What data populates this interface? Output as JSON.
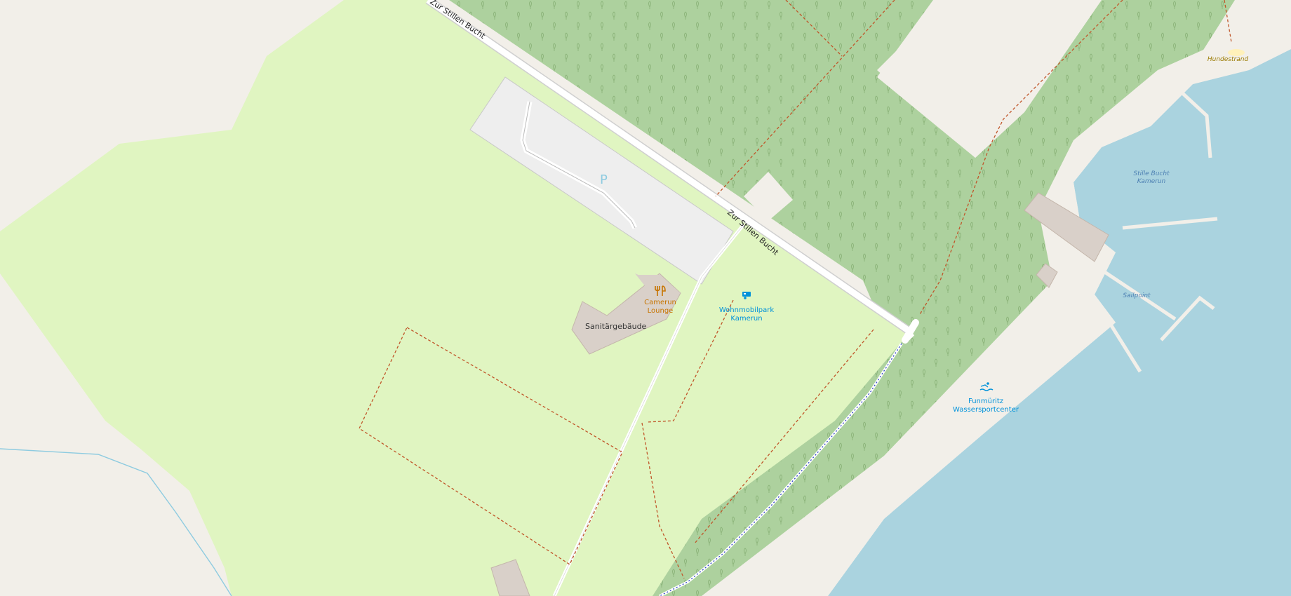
{
  "map": {
    "roads": {
      "road_label_top": "Zur Stillen Bucht",
      "road_label_mid": "Zur Stillen Bucht"
    },
    "parking": {
      "symbol": "P"
    },
    "buildings": {
      "sanitary": "Sanitärgebäude"
    },
    "pois": {
      "restaurant": {
        "line1": "Camerun",
        "line2": "Lounge",
        "icon": "restaurant-icon",
        "color": "#c77400"
      },
      "caravan": {
        "line1": "Wohnmobilpark",
        "line2": "Kamerun",
        "icon": "caravan-icon",
        "color": "#0092da"
      },
      "watersport": {
        "line1": "Funmüritz",
        "line2": "Wassersportcenter",
        "icon": "swimming-icon",
        "color": "#0092da"
      }
    },
    "water_labels": {
      "bay_line1": "Stille Bucht",
      "bay_line2": "Kamerun",
      "sailpoint": "Sailpoint",
      "dog_beach": "Hundestrand"
    },
    "colors": {
      "background": "#f2efe9",
      "grass": "#e0f5c1",
      "forest": "#add19e",
      "water": "#aad3df",
      "building": "#d9d0c9",
      "parking": "#eeeeee",
      "path": "#c0562a"
    }
  }
}
